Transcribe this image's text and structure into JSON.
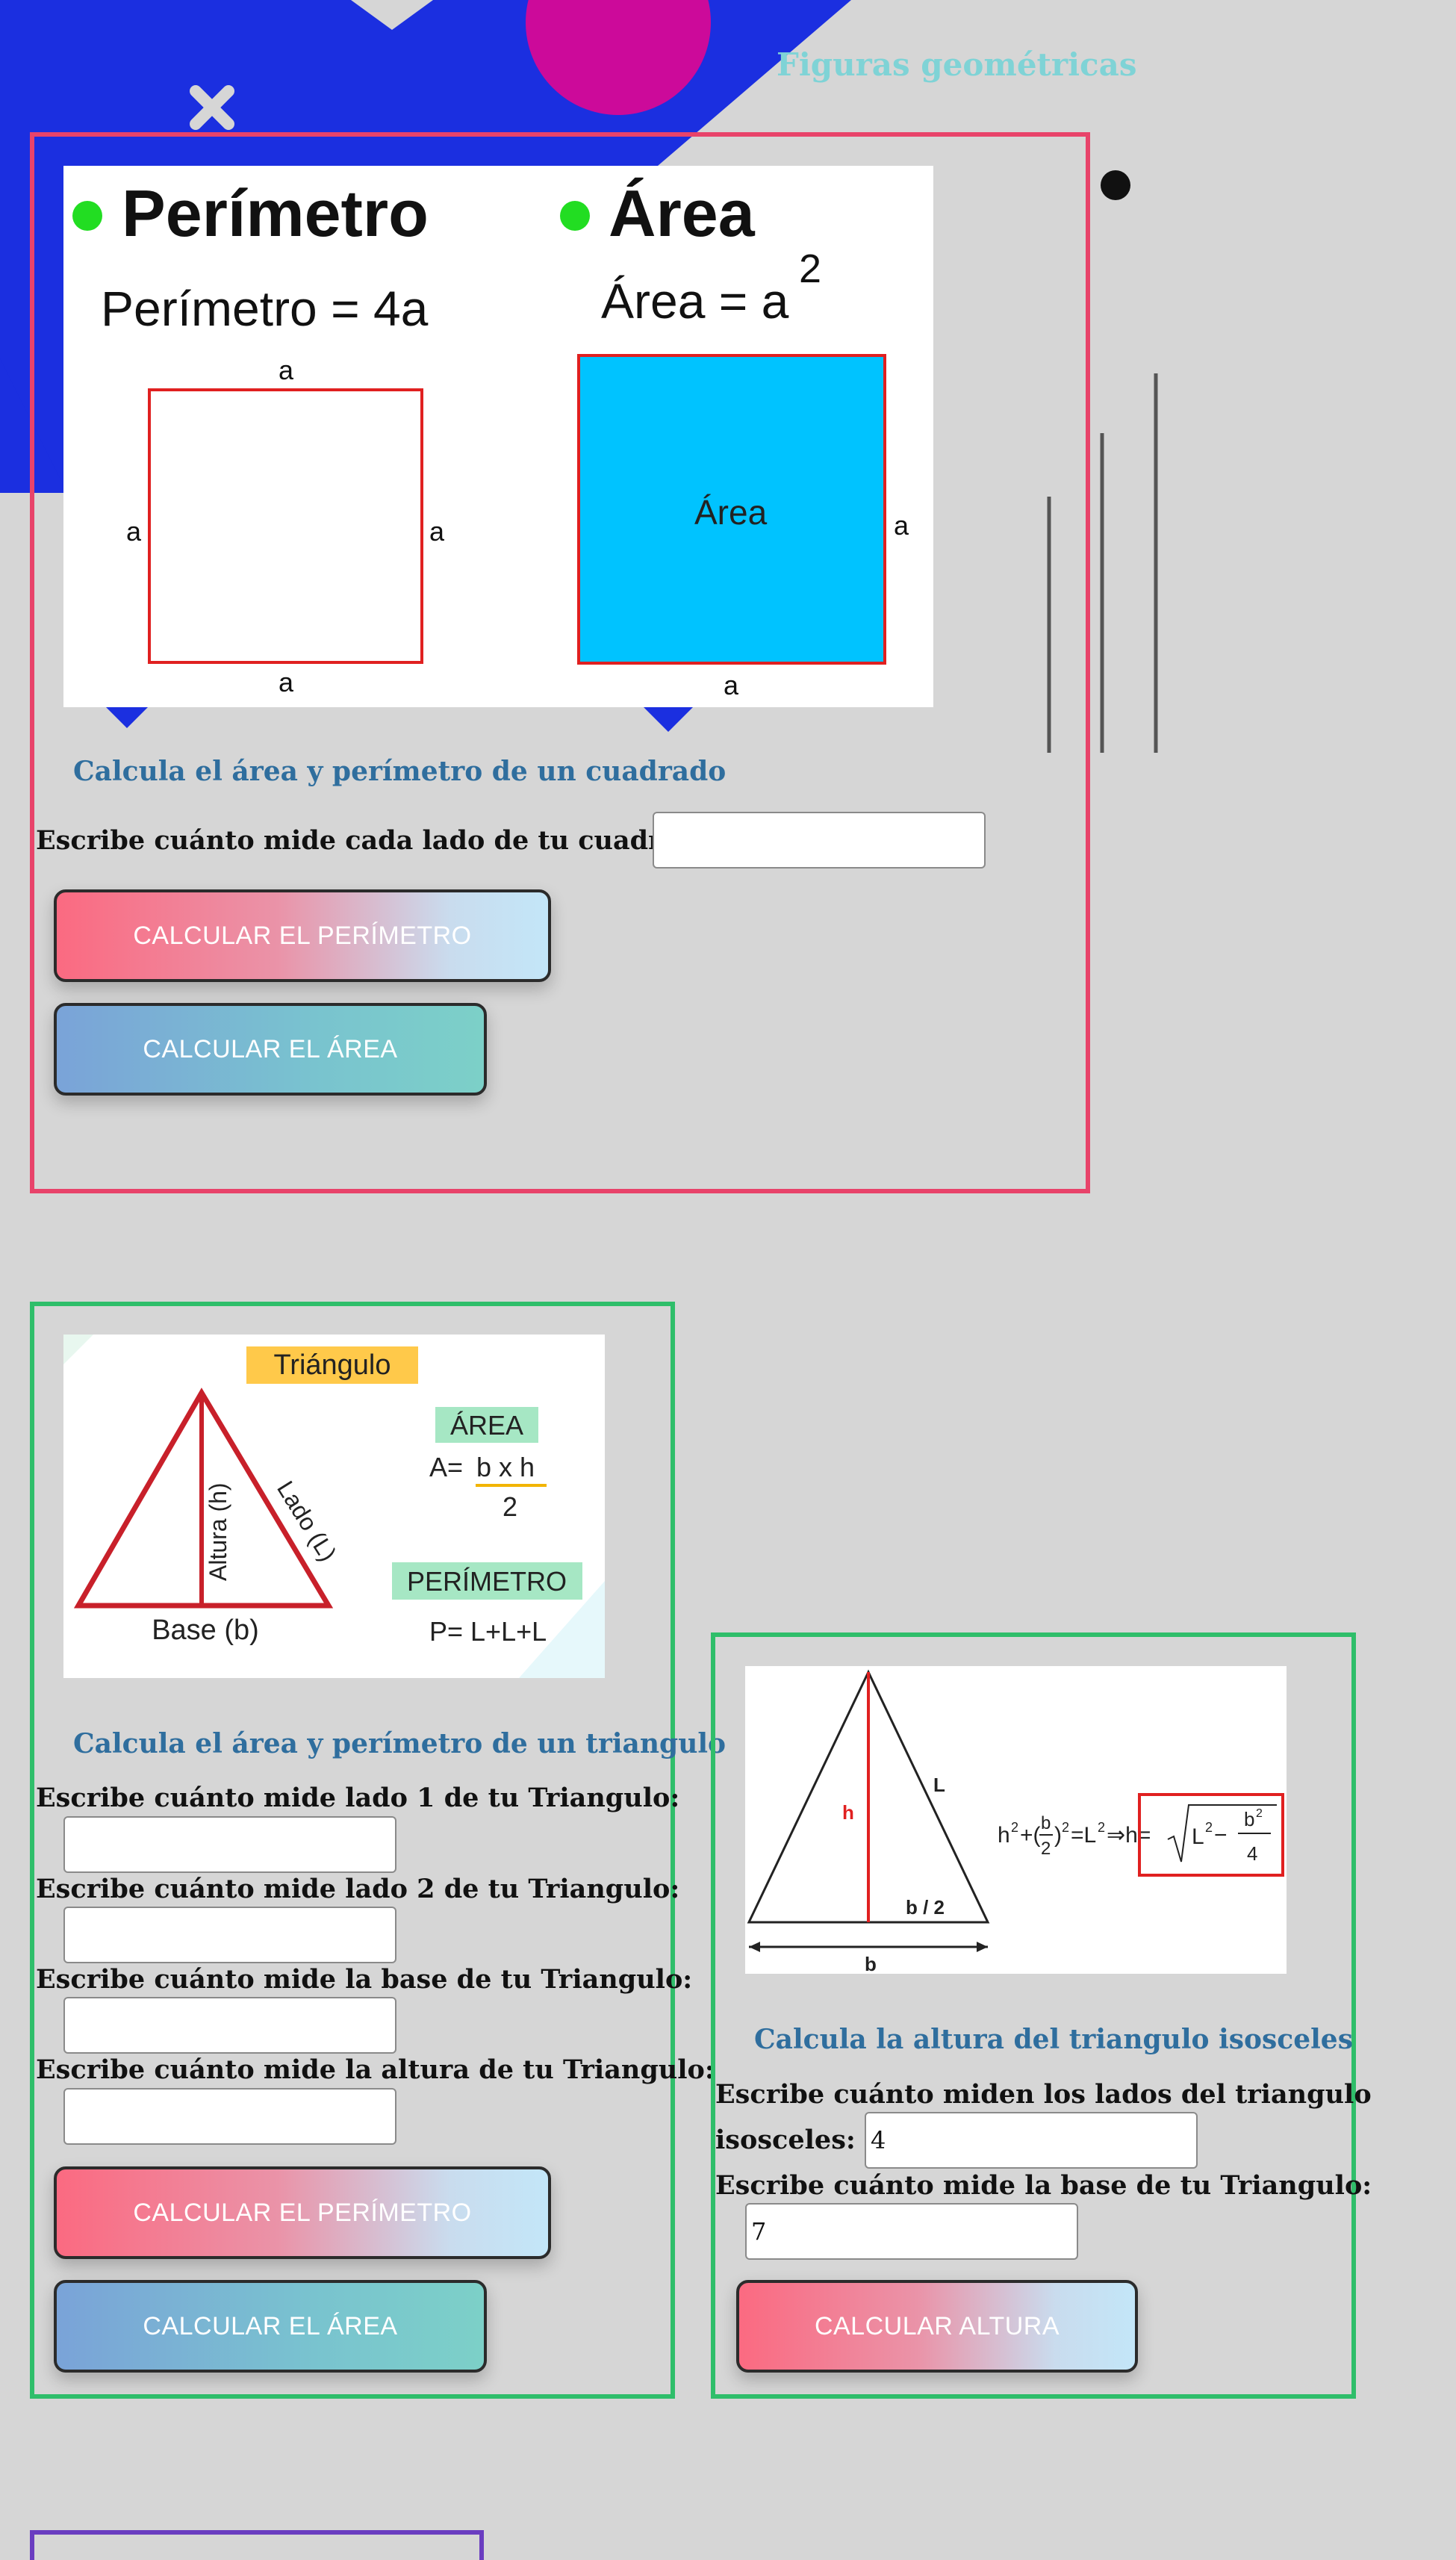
{
  "page": {
    "title": "Figuras geométricas"
  },
  "square": {
    "figure": {
      "perimeter_heading": "Perímetro",
      "perimeter_formula": "Perímetro = 4a",
      "area_heading": "Área",
      "area_formula": "Área = a",
      "area_exponent": "2",
      "side_label": "a",
      "area_box_label": "Área"
    },
    "heading": "Calcula el área y perímetro de un cuadrado",
    "side_label": "Escribe cuánto mide cada lado de tu cuadrado:",
    "side_value": "",
    "perimeter_button": "CALCULAR EL PERÍMETRO",
    "area_button": "CALCULAR EL ÁREA"
  },
  "triangle": {
    "figure": {
      "title": "Triángulo",
      "altura_label": "Altura (h)",
      "lado_label": "Lado (L)",
      "base_label": "Base (b)",
      "area_tag": "ÁREA",
      "area_formula_lhs": "A=",
      "area_formula_num": "b x h",
      "area_formula_den": "2",
      "perimeter_tag": "PERÍMETRO",
      "perimeter_formula": "P= L+L+L"
    },
    "heading": "Calcula el área y perímetro de un triangulo",
    "side1_label": "Escribe cuánto mide lado 1 de tu Triangulo:",
    "side1_value": "",
    "side2_label": "Escribe cuánto mide lado 2 de tu Triangulo:",
    "side2_value": "",
    "base_label": "Escribe cuánto mide la base de tu Triangulo:",
    "base_value": "",
    "height_label": "Escribe cuánto mide la altura de tu Triangulo:",
    "height_value": "",
    "perimeter_button": "CALCULAR EL PERÍMETRO",
    "area_button": "CALCULAR EL ÁREA"
  },
  "isosceles": {
    "figure": {
      "h_label": "h",
      "l_label": "L",
      "half_base_label": "b / 2",
      "base_label": "b"
    },
    "heading": "Calcula la altura del triangulo isosceles",
    "sides_label_line1": "Escribe cuánto miden los lados del triangulo",
    "sides_label_line2": "isosceles:",
    "sides_value": "4",
    "base_label": "Escribe cuánto mide la base de tu Triangulo:",
    "base_value": "7",
    "height_button": "CALCULAR ALTURA"
  },
  "colors": {
    "page_background": "#d6d6d6",
    "square_card_border": "#e8436a",
    "triangle_card_border": "#2fbe6a",
    "title_color": "#7fd3d6",
    "heading_color": "#2f6e9e",
    "decor_blue": "#1b2fe0",
    "decor_magenta": "#cc0a9a"
  }
}
